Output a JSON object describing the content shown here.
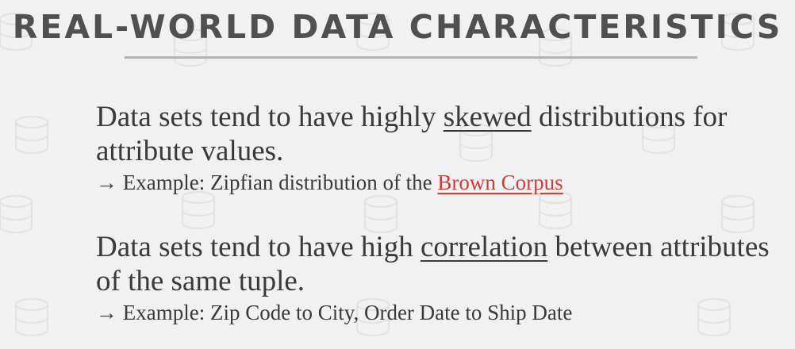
{
  "slide": {
    "title": "REAL-WORLD DATA CHARACTERISTICS",
    "bullets": [
      {
        "text_before": "Data sets tend to have highly ",
        "emphasis": "skewed",
        "text_after": " distributions for attribute values.",
        "sub": {
          "arrow": "→",
          "text": " Example: Zipfian distribution of the ",
          "link": "Brown Corpus"
        }
      },
      {
        "text_before": "Data sets tend to have high ",
        "emphasis": "correlation",
        "text_after": " between attributes of the same tuple.",
        "sub": {
          "arrow": "→",
          "text": " Example: Zip Code to City, Order Date to Ship Date"
        }
      }
    ]
  },
  "colors": {
    "background": "#f1f1f1",
    "title": "#505050",
    "body_text": "#3a3a3a",
    "link": "#d43a3a",
    "rule": "#b4b4b4"
  },
  "icons": {
    "background_pattern": "database-icon"
  }
}
